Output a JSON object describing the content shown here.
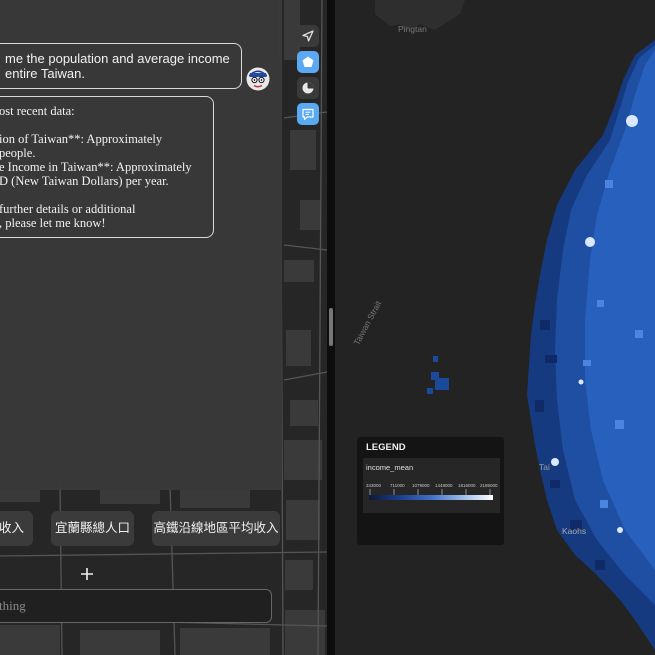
{
  "chat": {
    "user_message": {
      "lines": [
        "me the population and average income",
        "entire Taiwan."
      ]
    },
    "assistant_message": {
      "lines": [
        "ost recent data:",
        "",
        "ion of Taiwan**: Approximately",
        "people.",
        "e Income in Taiwan**: Approximately",
        "D (New Taiwan Dollars) per year.",
        "",
        "further details or additional",
        ", please let me know!"
      ]
    },
    "suggestions": [
      "收入",
      "宜蘭縣總人口",
      "高鐵沿線地區平均收入"
    ],
    "input": {
      "placeholder": "thing",
      "value": ""
    }
  },
  "toolbar": {
    "buttons": [
      {
        "icon": "navigate-arrow-icon",
        "active": false
      },
      {
        "icon": "pentagon-shape-icon",
        "active": true
      },
      {
        "icon": "pie-chart-icon",
        "active": false
      },
      {
        "icon": "chat-message-icon",
        "active": true
      }
    ]
  },
  "map": {
    "labels": {
      "pingtan": "Pingtan",
      "strait": "Taiwan Strait",
      "city_t": "Tai",
      "city_k": "Kaohs"
    },
    "legend": {
      "title": "LEGEND",
      "field": "income_mean",
      "ticks": [
        "343000",
        "711000",
        "1079000",
        "1448000",
        "1816000",
        "2185000"
      ],
      "gradient": [
        "#0d1a3a",
        "#1c3f8a",
        "#3f70c8",
        "#9ab8e8",
        "#ffffff"
      ]
    },
    "colors": {
      "accent": "#5aa9f2",
      "bubble_border": "#d9d9d9",
      "income_low": "#0d1a3a",
      "income_high": "#ffffff"
    }
  }
}
